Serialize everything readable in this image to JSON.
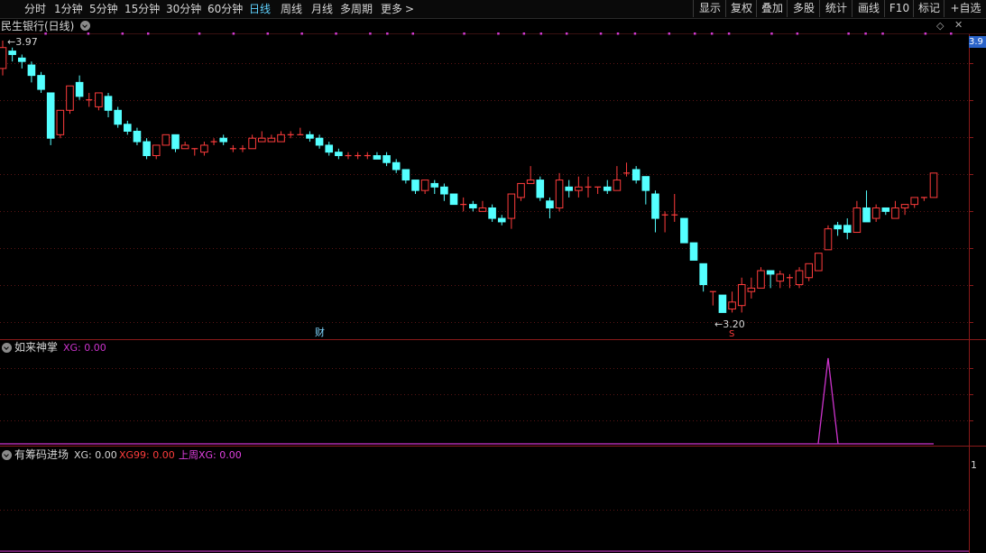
{
  "toolbar": {
    "tabs": [
      "分时",
      "1分钟",
      "5分钟",
      "15分钟",
      "30分钟",
      "60分钟",
      "日线",
      "周线",
      "月线",
      "多周期",
      "更多"
    ],
    "active_tab": "日线",
    "more_arrow": ">",
    "right_buttons": [
      "显示",
      "复权",
      "叠加",
      "多股",
      "统计",
      "画线",
      "F10",
      "标记",
      "+自选"
    ]
  },
  "main": {
    "title": "民生银行(日线)",
    "high_label": "3.97",
    "low_label": "3.20",
    "right_price": "3.9",
    "fin_marker": "财",
    "signal_marker": "S",
    "up_color": "#ff3c3c",
    "down_color": "#54ffff"
  },
  "ind1": {
    "name": "如来神掌",
    "xg_label": "XG: 0.00",
    "color": "#cc33cc"
  },
  "ind2": {
    "name": "有筹码进场",
    "xg_label": "XG: 0.00",
    "xg99_label": "XG99: 0.00",
    "weekly_label": "上周XG: 0.00",
    "right_tick": "1"
  },
  "chart_data": {
    "type": "candlestick",
    "ylim": [
      3.17,
      3.98
    ],
    "candles": [
      [
        3.9,
        3.96,
        3.98,
        3.88
      ],
      [
        3.95,
        3.94,
        3.96,
        3.92
      ],
      [
        3.93,
        3.92,
        3.94,
        3.9
      ],
      [
        3.91,
        3.88,
        3.92,
        3.86
      ],
      [
        3.88,
        3.84,
        3.89,
        3.83
      ],
      [
        3.83,
        3.7,
        3.83,
        3.68
      ],
      [
        3.71,
        3.78,
        3.78,
        3.7
      ],
      [
        3.78,
        3.85,
        3.85,
        3.77
      ],
      [
        3.86,
        3.82,
        3.88,
        3.81
      ],
      [
        3.81,
        3.81,
        3.83,
        3.79
      ],
      [
        3.79,
        3.83,
        3.83,
        3.78
      ],
      [
        3.82,
        3.78,
        3.83,
        3.76
      ],
      [
        3.78,
        3.74,
        3.79,
        3.73
      ],
      [
        3.74,
        3.72,
        3.75,
        3.71
      ],
      [
        3.72,
        3.69,
        3.73,
        3.68
      ],
      [
        3.69,
        3.65,
        3.7,
        3.64
      ],
      [
        3.65,
        3.68,
        3.68,
        3.64
      ],
      [
        3.68,
        3.71,
        3.71,
        3.68
      ],
      [
        3.71,
        3.67,
        3.71,
        3.66
      ],
      [
        3.67,
        3.68,
        3.69,
        3.67
      ],
      [
        3.67,
        3.67,
        3.67,
        3.65
      ],
      [
        3.66,
        3.68,
        3.69,
        3.65
      ],
      [
        3.69,
        3.69,
        3.7,
        3.68
      ],
      [
        3.7,
        3.69,
        3.71,
        3.68
      ],
      [
        3.67,
        3.67,
        3.68,
        3.66
      ],
      [
        3.67,
        3.67,
        3.68,
        3.66
      ],
      [
        3.67,
        3.7,
        3.71,
        3.67
      ],
      [
        3.69,
        3.7,
        3.72,
        3.69
      ],
      [
        3.69,
        3.7,
        3.71,
        3.69
      ],
      [
        3.69,
        3.71,
        3.72,
        3.69
      ],
      [
        3.71,
        3.71,
        3.72,
        3.7
      ],
      [
        3.71,
        3.71,
        3.73,
        3.71
      ],
      [
        3.71,
        3.7,
        3.72,
        3.69
      ],
      [
        3.7,
        3.68,
        3.71,
        3.67
      ],
      [
        3.68,
        3.66,
        3.69,
        3.65
      ],
      [
        3.66,
        3.65,
        3.67,
        3.64
      ],
      [
        3.65,
        3.65,
        3.66,
        3.64
      ],
      [
        3.65,
        3.65,
        3.66,
        3.64
      ],
      [
        3.65,
        3.65,
        3.66,
        3.64
      ],
      [
        3.65,
        3.64,
        3.66,
        3.64
      ],
      [
        3.65,
        3.63,
        3.66,
        3.62
      ],
      [
        3.63,
        3.61,
        3.64,
        3.6
      ],
      [
        3.61,
        3.58,
        3.61,
        3.57
      ],
      [
        3.58,
        3.55,
        3.58,
        3.54
      ],
      [
        3.55,
        3.58,
        3.58,
        3.54
      ],
      [
        3.57,
        3.56,
        3.58,
        3.54
      ],
      [
        3.56,
        3.54,
        3.57,
        3.52
      ],
      [
        3.54,
        3.51,
        3.54,
        3.51
      ],
      [
        3.51,
        3.51,
        3.53,
        3.49
      ],
      [
        3.51,
        3.5,
        3.52,
        3.49
      ],
      [
        3.49,
        3.5,
        3.52,
        3.49
      ],
      [
        3.5,
        3.47,
        3.51,
        3.46
      ],
      [
        3.47,
        3.46,
        3.48,
        3.45
      ],
      [
        3.47,
        3.54,
        3.54,
        3.44
      ],
      [
        3.53,
        3.57,
        3.57,
        3.52
      ],
      [
        3.57,
        3.58,
        3.62,
        3.57
      ],
      [
        3.58,
        3.53,
        3.59,
        3.52
      ],
      [
        3.52,
        3.5,
        3.53,
        3.47
      ],
      [
        3.5,
        3.58,
        3.6,
        3.49
      ],
      [
        3.56,
        3.55,
        3.58,
        3.53
      ],
      [
        3.55,
        3.56,
        3.59,
        3.53
      ],
      [
        3.56,
        3.56,
        3.59,
        3.53
      ],
      [
        3.56,
        3.56,
        3.56,
        3.54
      ],
      [
        3.56,
        3.55,
        3.58,
        3.54
      ],
      [
        3.55,
        3.58,
        3.62,
        3.55
      ],
      [
        3.6,
        3.6,
        3.63,
        3.59
      ],
      [
        3.61,
        3.58,
        3.62,
        3.57
      ],
      [
        3.59,
        3.55,
        3.59,
        3.51
      ],
      [
        3.54,
        3.47,
        3.55,
        3.43
      ],
      [
        3.48,
        3.48,
        3.49,
        3.43
      ],
      [
        3.48,
        3.48,
        3.54,
        3.46
      ],
      [
        3.47,
        3.4,
        3.47,
        3.4
      ],
      [
        3.4,
        3.35,
        3.4,
        3.35
      ],
      [
        3.34,
        3.28,
        3.34,
        3.26
      ],
      [
        3.26,
        3.26,
        3.26,
        3.22
      ],
      [
        3.25,
        3.2,
        3.25,
        3.2
      ],
      [
        3.21,
        3.23,
        3.26,
        3.2
      ],
      [
        3.22,
        3.28,
        3.3,
        3.2
      ],
      [
        3.26,
        3.27,
        3.3,
        3.24
      ],
      [
        3.27,
        3.32,
        3.33,
        3.27
      ],
      [
        3.32,
        3.31,
        3.32,
        3.27
      ],
      [
        3.29,
        3.31,
        3.32,
        3.27
      ],
      [
        3.3,
        3.3,
        3.31,
        3.27
      ],
      [
        3.28,
        3.32,
        3.33,
        3.27
      ],
      [
        3.3,
        3.34,
        3.34,
        3.29
      ],
      [
        3.32,
        3.37,
        3.37,
        3.32
      ],
      [
        3.38,
        3.44,
        3.45,
        3.38
      ],
      [
        3.45,
        3.44,
        3.46,
        3.42
      ],
      [
        3.45,
        3.43,
        3.47,
        3.41
      ],
      [
        3.43,
        3.5,
        3.52,
        3.43
      ],
      [
        3.5,
        3.46,
        3.55,
        3.46
      ],
      [
        3.47,
        3.5,
        3.51,
        3.46
      ],
      [
        3.5,
        3.49,
        3.5,
        3.48
      ],
      [
        3.47,
        3.5,
        3.52,
        3.47
      ],
      [
        3.5,
        3.51,
        3.51,
        3.48
      ],
      [
        3.51,
        3.53,
        3.53,
        3.5
      ],
      [
        3.53,
        3.53,
        3.53,
        3.52
      ],
      [
        3.53,
        3.6,
        3.6,
        3.53
      ]
    ],
    "indicator1_spike_index": 86
  }
}
